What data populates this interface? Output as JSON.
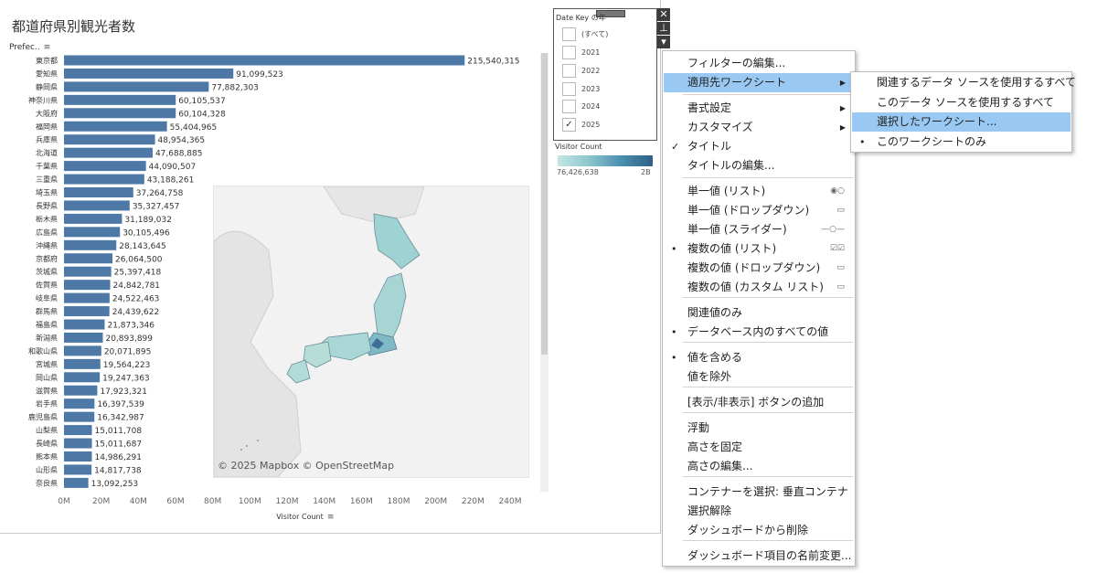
{
  "dashboard": {
    "title": "都道府県別観光者数",
    "row_header": "Prefec..",
    "axis_title": "Visitor Count",
    "map_credit": "© 2025 Mapbox © OpenStreetMap"
  },
  "chart_data": {
    "type": "bar",
    "orientation": "horizontal",
    "title": "",
    "xlabel": "Visitor Count",
    "ylabel": "Prefec..",
    "xlim": [
      0,
      240000000
    ],
    "x_ticks": [
      "0M",
      "20M",
      "40M",
      "60M",
      "80M",
      "100M",
      "120M",
      "140M",
      "160M",
      "180M",
      "200M",
      "220M",
      "240M"
    ],
    "categories": [
      "東京都",
      "愛知県",
      "静岡県",
      "神奈川県",
      "大阪府",
      "福岡県",
      "兵庫県",
      "北海道",
      "千葉県",
      "三重県",
      "埼玉県",
      "長野県",
      "栃木県",
      "広島県",
      "沖縄県",
      "京都府",
      "茨城県",
      "佐賀県",
      "岐阜県",
      "群馬県",
      "福島県",
      "新潟県",
      "和歌山県",
      "宮城県",
      "岡山県",
      "滋賀県",
      "岩手県",
      "鹿児島県",
      "山梨県",
      "長崎県",
      "熊本県",
      "山形県",
      "奈良県"
    ],
    "values": [
      215540315,
      91099523,
      77882303,
      60105537,
      60104328,
      55404965,
      48954365,
      47688885,
      44090507,
      43188261,
      37264758,
      35327457,
      31189032,
      30105496,
      28143645,
      26064500,
      25397418,
      24842781,
      24522463,
      24439622,
      21873346,
      20893899,
      20071895,
      19564223,
      19247363,
      17923321,
      16397539,
      16342987,
      15011708,
      15011687,
      14986291,
      14817738,
      13092253
    ],
    "labels": [
      "215,540,315",
      "91,099,523",
      "77,882,303",
      "60,105,537",
      "60,104,328",
      "55,404,965",
      "48,954,365",
      "47,688,885",
      "44,090,507",
      "43,188,261",
      "37,264,758",
      "35,327,457",
      "31,189,032",
      "30,105,496",
      "28,143,645",
      "26,064,500",
      "25,397,418",
      "24,842,781",
      "24,522,463",
      "24,439,622",
      "21,873,346",
      "20,893,899",
      "20,071,895",
      "19,564,223",
      "19,247,363",
      "17,923,321",
      "16,397,539",
      "16,342,987",
      "15,011,708",
      "15,011,687",
      "14,986,291",
      "14,817,738",
      "13,092,253"
    ],
    "bar_color": "#4e79a7",
    "grid": false
  },
  "filter": {
    "title": "Date Key の年",
    "options": [
      {
        "label": "(すべて)",
        "checked": ""
      },
      {
        "label": "2021",
        "checked": ""
      },
      {
        "label": "2022",
        "checked": ""
      },
      {
        "label": "2023",
        "checked": ""
      },
      {
        "label": "2024",
        "checked": ""
      },
      {
        "label": "2025",
        "checked": "✓"
      }
    ]
  },
  "legend": {
    "title": "Visitor Count",
    "min": "76,426,638",
    "max": "2B",
    "colors": [
      "#c4e6e3",
      "#2f5f86"
    ]
  },
  "window_controls": {
    "close": "✕",
    "pin": "⊥",
    "more": "▾"
  },
  "context_menu": {
    "items": [
      {
        "label": "フィルターの編集...",
        "mark": "",
        "arrow": "",
        "icon": ""
      },
      {
        "label": "適用先ワークシート",
        "mark": "",
        "arrow": "▶",
        "icon": ""
      },
      {
        "label": "書式設定",
        "mark": "",
        "arrow": "▶",
        "icon": ""
      },
      {
        "label": "カスタマイズ",
        "mark": "",
        "arrow": "▶",
        "icon": ""
      },
      {
        "label": "タイトル",
        "mark": "✓",
        "arrow": "",
        "icon": ""
      },
      {
        "label": "タイトルの編集...",
        "mark": "",
        "arrow": "",
        "icon": ""
      },
      {
        "label": "単一値 (リスト)",
        "mark": "",
        "arrow": "",
        "icon": "◉○"
      },
      {
        "label": "単一値 (ドロップダウン)",
        "mark": "",
        "arrow": "",
        "icon": "▭"
      },
      {
        "label": "単一値 (スライダー)",
        "mark": "",
        "arrow": "",
        "icon": "—○—"
      },
      {
        "label": "複数の値 (リスト)",
        "mark": "•",
        "arrow": "",
        "icon": "☑☑"
      },
      {
        "label": "複数の値 (ドロップダウン)",
        "mark": "",
        "arrow": "",
        "icon": "▭"
      },
      {
        "label": "複数の値 (カスタム リスト)",
        "mark": "",
        "arrow": "",
        "icon": "▭"
      },
      {
        "label": "関連値のみ",
        "mark": "",
        "arrow": "",
        "icon": ""
      },
      {
        "label": "データベース内のすべての値",
        "mark": "•",
        "arrow": "",
        "icon": ""
      },
      {
        "label": "値を含める",
        "mark": "•",
        "arrow": "",
        "icon": ""
      },
      {
        "label": "値を除外",
        "mark": "",
        "arrow": "",
        "icon": ""
      },
      {
        "label": "[表示/非表示] ボタンの追加",
        "mark": "",
        "arrow": "",
        "icon": ""
      },
      {
        "label": "浮動",
        "mark": "",
        "arrow": "",
        "icon": ""
      },
      {
        "label": "高さを固定",
        "mark": "",
        "arrow": "",
        "icon": ""
      },
      {
        "label": "高さの編集...",
        "mark": "",
        "arrow": "",
        "icon": ""
      },
      {
        "label": "コンテナーを選択: 垂直コンテナ",
        "mark": "",
        "arrow": "",
        "icon": ""
      },
      {
        "label": "選択解除",
        "mark": "",
        "arrow": "",
        "icon": ""
      },
      {
        "label": "ダッシュボードから削除",
        "mark": "",
        "arrow": "",
        "icon": ""
      },
      {
        "label": "ダッシュボード項目の名前変更...",
        "mark": "",
        "arrow": "",
        "icon": ""
      }
    ],
    "highlighted_index": 1
  },
  "submenu": {
    "items": [
      {
        "label": "関連するデータ ソースを使用するすべて",
        "mark": ""
      },
      {
        "label": "このデータ ソースを使用するすべて",
        "mark": ""
      },
      {
        "label": "選択したワークシート...",
        "mark": ""
      },
      {
        "label": "このワークシートのみ",
        "mark": "•"
      }
    ],
    "highlighted_index": 2
  }
}
